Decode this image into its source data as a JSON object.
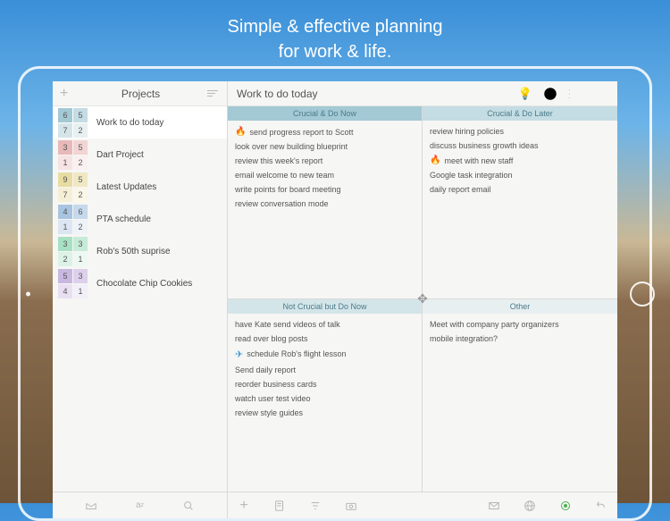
{
  "marketing": {
    "line1": "Simple & effective planning",
    "line2": "for work & life."
  },
  "sidebar": {
    "title": "Projects",
    "projects": [
      {
        "name": "Work to do today",
        "counts": [
          6,
          5,
          7,
          2
        ],
        "colors": [
          "#a3c9d4",
          "#c4dce3",
          "#d4e5e9",
          "#e8eff1"
        ],
        "selected": true
      },
      {
        "name": "Dart Project",
        "counts": [
          3,
          5,
          1,
          2
        ],
        "colors": [
          "#e8b9b9",
          "#f2d4d4",
          "#f6e3e3",
          "#fbf0f0"
        ]
      },
      {
        "name": "Latest Updates",
        "counts": [
          9,
          5,
          7,
          2
        ],
        "colors": [
          "#e8dca3",
          "#f0e8c4",
          "#f5efd6",
          "#faf6e8"
        ]
      },
      {
        "name": "PTA schedule",
        "counts": [
          4,
          6,
          1,
          2
        ],
        "colors": [
          "#a8c4e0",
          "#c6d8eb",
          "#dce6f2",
          "#eef3f8"
        ]
      },
      {
        "name": "Rob's 50th suprise",
        "counts": [
          3,
          3,
          2,
          1
        ],
        "colors": [
          "#a8e0c4",
          "#c6ebd8",
          "#dcf2e6",
          "#eef8f3"
        ]
      },
      {
        "name": "Chocolate Chip Cookies",
        "counts": [
          5,
          3,
          4,
          1
        ],
        "colors": [
          "#c8b8e0",
          "#dcd0eb",
          "#e8e0f2",
          "#f3eff8"
        ]
      }
    ]
  },
  "main": {
    "title": "Work to do today",
    "quadrants": [
      {
        "header": "Crucial & Do Now",
        "tasks": [
          {
            "icon": "fire",
            "text": "send progress report to Scott"
          },
          {
            "text": "look over new building blueprint"
          },
          {
            "text": "review this week's report"
          },
          {
            "text": "email welcome to new team"
          },
          {
            "text": "write points for board meeting"
          },
          {
            "text": "review conversation mode"
          }
        ]
      },
      {
        "header": "Crucial & Do Later",
        "tasks": [
          {
            "text": "review hiring policies"
          },
          {
            "text": "discuss business growth ideas"
          },
          {
            "icon": "fire",
            "text": "meet with new staff"
          },
          {
            "text": "Google task integration"
          },
          {
            "text": "daily report email"
          }
        ]
      },
      {
        "header": "Not Crucial but Do Now",
        "tasks": [
          {
            "text": "have Kate send videos of talk"
          },
          {
            "text": "read over blog posts"
          },
          {
            "icon": "plane",
            "text": "schedule Rob's flight lesson"
          },
          {
            "text": "Send daily report"
          },
          {
            "text": "reorder business cards"
          },
          {
            "text": "watch user test video"
          },
          {
            "text": "review style guides"
          }
        ]
      },
      {
        "header": "Other",
        "tasks": [
          {
            "text": "Meet with company party organizers"
          },
          {
            "text": "mobile integration?"
          }
        ]
      }
    ]
  }
}
